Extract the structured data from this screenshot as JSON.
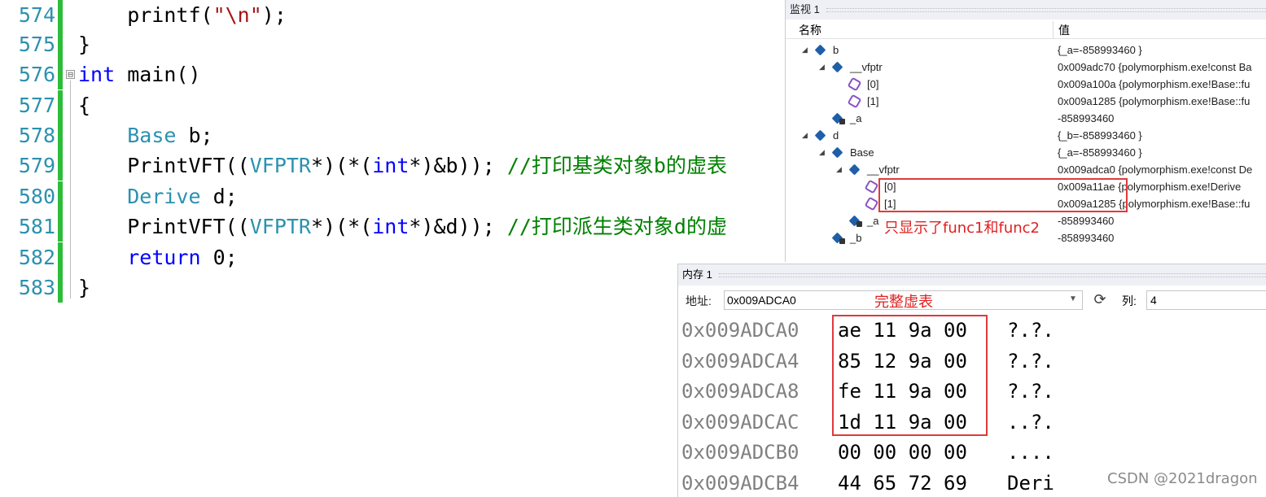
{
  "editor": {
    "lines": [
      {
        "num": "574",
        "segments": [
          {
            "t": "    printf(",
            "c": ""
          },
          {
            "t": "\"\\n\"",
            "c": "str"
          },
          {
            "t": ");",
            "c": ""
          }
        ]
      },
      {
        "num": "575",
        "segments": [
          {
            "t": "}",
            "c": ""
          }
        ]
      },
      {
        "num": "576",
        "segments": [
          {
            "t": "int",
            "c": "kw"
          },
          {
            "t": " main()",
            "c": ""
          }
        ]
      },
      {
        "num": "577",
        "segments": [
          {
            "t": "{",
            "c": ""
          }
        ]
      },
      {
        "num": "578",
        "segments": [
          {
            "t": "    ",
            "c": ""
          },
          {
            "t": "Base",
            "c": "ty"
          },
          {
            "t": " b;",
            "c": ""
          }
        ]
      },
      {
        "num": "579",
        "segments": [
          {
            "t": "    PrintVFT((",
            "c": ""
          },
          {
            "t": "VFPTR",
            "c": "ty"
          },
          {
            "t": "*)(*(",
            "c": ""
          },
          {
            "t": "int",
            "c": "kw"
          },
          {
            "t": "*)&b)); ",
            "c": ""
          },
          {
            "t": "//打印基类对象b的虚表",
            "c": "cm"
          }
        ]
      },
      {
        "num": "580",
        "segments": [
          {
            "t": "    ",
            "c": ""
          },
          {
            "t": "Derive",
            "c": "ty"
          },
          {
            "t": " d;",
            "c": ""
          }
        ]
      },
      {
        "num": "581",
        "segments": [
          {
            "t": "    PrintVFT((",
            "c": ""
          },
          {
            "t": "VFPTR",
            "c": "ty"
          },
          {
            "t": "*)(*(",
            "c": ""
          },
          {
            "t": "int",
            "c": "kw"
          },
          {
            "t": "*)&d)); ",
            "c": ""
          },
          {
            "t": "//打印派生类对象d的虚",
            "c": "cm"
          }
        ]
      },
      {
        "num": "582",
        "segments": [
          {
            "t": "    ",
            "c": ""
          },
          {
            "t": "return",
            "c": "kw"
          },
          {
            "t": " 0;",
            "c": ""
          }
        ]
      },
      {
        "num": "583",
        "segments": [
          {
            "t": "}",
            "c": ""
          }
        ]
      }
    ],
    "fold_marker": "⊟"
  },
  "watch": {
    "title": "监视 1",
    "col_name": "名称",
    "col_value": "值",
    "rows": [
      {
        "name": "b",
        "value": "{_a=-858993460 }",
        "indent": 0,
        "expander": "◢",
        "icon": "cube"
      },
      {
        "name": "__vfptr",
        "value": "0x009adc70 {polymorphism.exe!const Ba",
        "indent": 1,
        "expander": "◢",
        "icon": "cube"
      },
      {
        "name": "[0]",
        "value": "0x009a100a {polymorphism.exe!Base::fu",
        "indent": 2,
        "expander": "",
        "icon": "purple"
      },
      {
        "name": "[1]",
        "value": "0x009a1285 {polymorphism.exe!Base::fu",
        "indent": 2,
        "expander": "",
        "icon": "purple"
      },
      {
        "name": "_a",
        "value": "-858993460",
        "indent": 1,
        "expander": "",
        "icon": "lockcube"
      },
      {
        "name": "d",
        "value": "{_b=-858993460 }",
        "indent": 0,
        "expander": "◢",
        "icon": "cube"
      },
      {
        "name": "Base",
        "value": "{_a=-858993460 }",
        "indent": 1,
        "expander": "◢",
        "icon": "cube"
      },
      {
        "name": "__vfptr",
        "value": "0x009adca0 {polymorphism.exe!const De",
        "indent": 2,
        "expander": "◢",
        "icon": "cube"
      },
      {
        "name": "[0]",
        "value": "0x009a11ae {polymorphism.exe!Derive",
        "indent": 3,
        "expander": "",
        "icon": "purple"
      },
      {
        "name": "[1]",
        "value": "0x009a1285 {polymorphism.exe!Base::fu",
        "indent": 3,
        "expander": "",
        "icon": "purple"
      },
      {
        "name": "_a",
        "value": "-858993460",
        "indent": 2,
        "expander": "",
        "icon": "lockcube"
      },
      {
        "name": "_b",
        "value": "-858993460",
        "indent": 1,
        "expander": "",
        "icon": "lockcube"
      }
    ],
    "annotation": "只显示了func1和func2"
  },
  "memory": {
    "title": "内存 1",
    "address_label": "地址:",
    "address_value": "0x009ADCA0",
    "columns_label": "列:",
    "columns_value": "4",
    "annotation": "完整虚表",
    "rows": [
      {
        "addr": "0x009ADCA0",
        "bytes": "ae 11 9a 00",
        "ascii": "?.?."
      },
      {
        "addr": "0x009ADCA4",
        "bytes": "85 12 9a 00",
        "ascii": "?.?."
      },
      {
        "addr": "0x009ADCA8",
        "bytes": "fe 11 9a 00",
        "ascii": "?.?."
      },
      {
        "addr": "0x009ADCAC",
        "bytes": "1d 11 9a 00",
        "ascii": "..?."
      },
      {
        "addr": "0x009ADCB0",
        "bytes": "00 00 00 00",
        "ascii": "...."
      },
      {
        "addr": "0x009ADCB4",
        "bytes": "44 65 72 69",
        "ascii": "Deri"
      }
    ]
  },
  "watermark": "CSDN @2021dragon",
  "colors": {
    "highlight": "#e03a3a",
    "gutter": "#2dbd39",
    "keyword": "#0000ff",
    "type": "#2b91af",
    "comment": "#008000",
    "string": "#a31515"
  }
}
